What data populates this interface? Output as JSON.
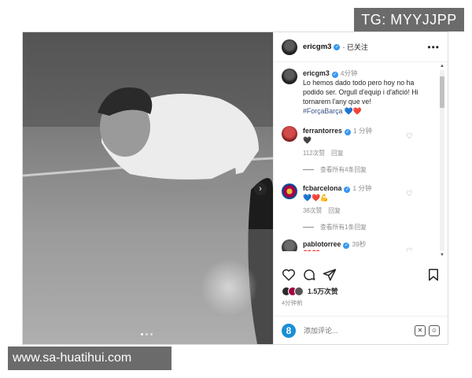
{
  "watermarks": {
    "tg": "TG: MYYJJPP",
    "site": "www.sa-huatihui.com"
  },
  "header": {
    "username": "ericgm3",
    "follow_status": "· 已关注",
    "more": "•••"
  },
  "caption": {
    "username": "ericgm3",
    "time": "4分钟",
    "text": "Lo hemos dado todo pero hoy no ha podido ser. Orgull d'equip i d'afició! Hi tornarem l'any que ve!",
    "hashtag": "#ForçaBarça",
    "emoji": "💙❤️"
  },
  "comments": [
    {
      "username": "ferrantorres",
      "time": "1 分钟",
      "text": "🖤",
      "likes": "112次赞",
      "reply": "回复",
      "view_replies": "查看所有4条回复"
    },
    {
      "username": "fcbarcelona",
      "time": "1 分钟",
      "text": "💙❤️💪",
      "likes": "38次赞",
      "reply": "回复",
      "view_replies": "查看所有1条回复"
    },
    {
      "username": "pablotorree",
      "time": "39秒",
      "text": "❤️❤️"
    }
  ],
  "likes": {
    "count": "1.5万次赞"
  },
  "posted": "4分钟前",
  "add_comment": {
    "placeholder": "添加评论..."
  },
  "carousel": {
    "next": "›",
    "slide": 1,
    "total": 3
  },
  "colors": {
    "verified": "#3897f0",
    "hashtag": "#385185",
    "muted": "#8e8e8e"
  },
  "icons": [
    "heart-icon",
    "comment-icon",
    "share-icon",
    "bookmark-icon",
    "emoji-icon",
    "chevron-right-icon"
  ]
}
